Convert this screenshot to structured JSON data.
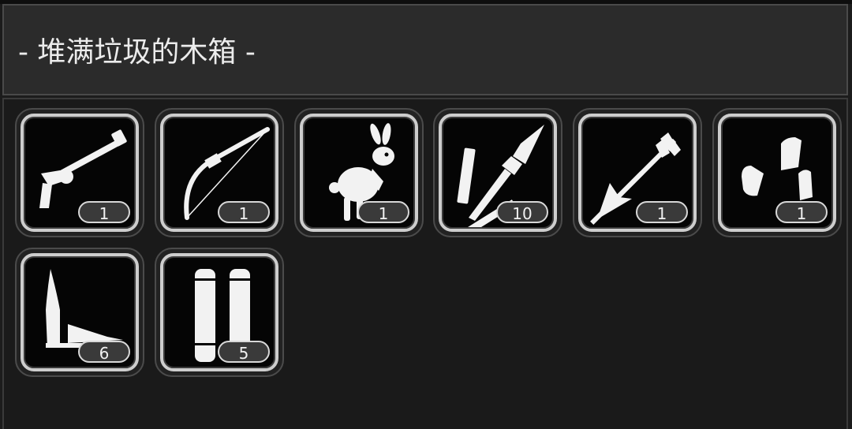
{
  "window": {
    "title": "- 堆满垃圾的木箱 -"
  },
  "items": [
    {
      "icon": "revolver-icon",
      "count": "1"
    },
    {
      "icon": "bow-icon",
      "count": "1"
    },
    {
      "icon": "rabbit-icon",
      "count": "1"
    },
    {
      "icon": "spear-arrow-shaft-icon",
      "count": "10"
    },
    {
      "icon": "arrow-icon",
      "count": "1"
    },
    {
      "icon": "bullets-icon",
      "count": "1"
    },
    {
      "icon": "rifle-cartridge-icon",
      "count": "6"
    },
    {
      "icon": "shotgun-shells-icon",
      "count": "5"
    }
  ]
}
